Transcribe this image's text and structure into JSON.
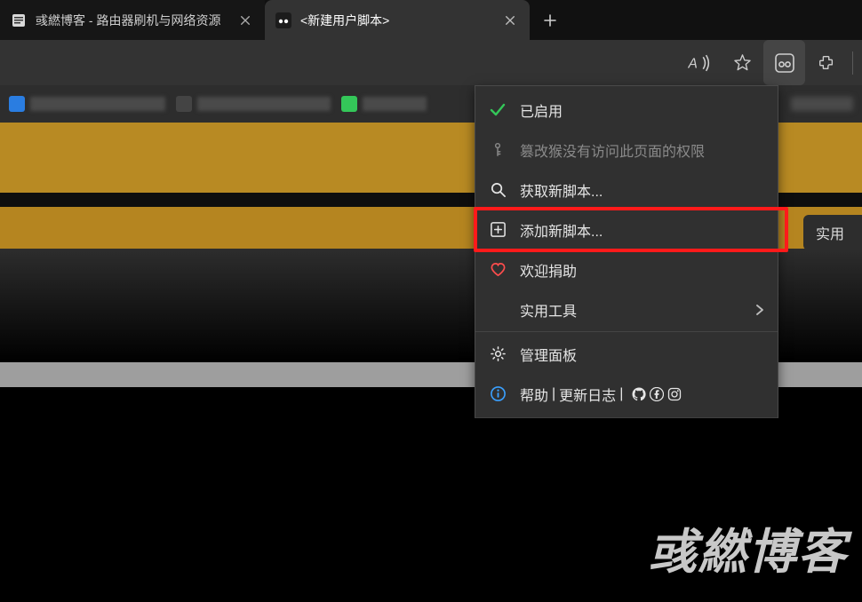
{
  "tabs": [
    {
      "title": "彧繎博客 - 路由器刷机与网络资源",
      "active": false
    },
    {
      "title": "<新建用户脚本>",
      "active": true
    }
  ],
  "toolbar": {
    "read_aloud": "AI",
    "favorite": "star-icon",
    "extension": "tampermonkey-icon",
    "more": "extensions-icon"
  },
  "menu": {
    "enabled": "已启用",
    "no_access": "篡改猴没有访问此页面的权限",
    "get_scripts": "获取新脚本...",
    "add_script": "添加新脚本...",
    "donate": "欢迎捐助",
    "utilities": "实用工具",
    "dashboard": "管理面板",
    "help_label": "帮助",
    "help_sep": " | ",
    "changelog": "更新日志",
    "help_links": " | "
  },
  "page": {
    "right_button_fragment": "实用"
  },
  "watermark": "彧繎博客"
}
